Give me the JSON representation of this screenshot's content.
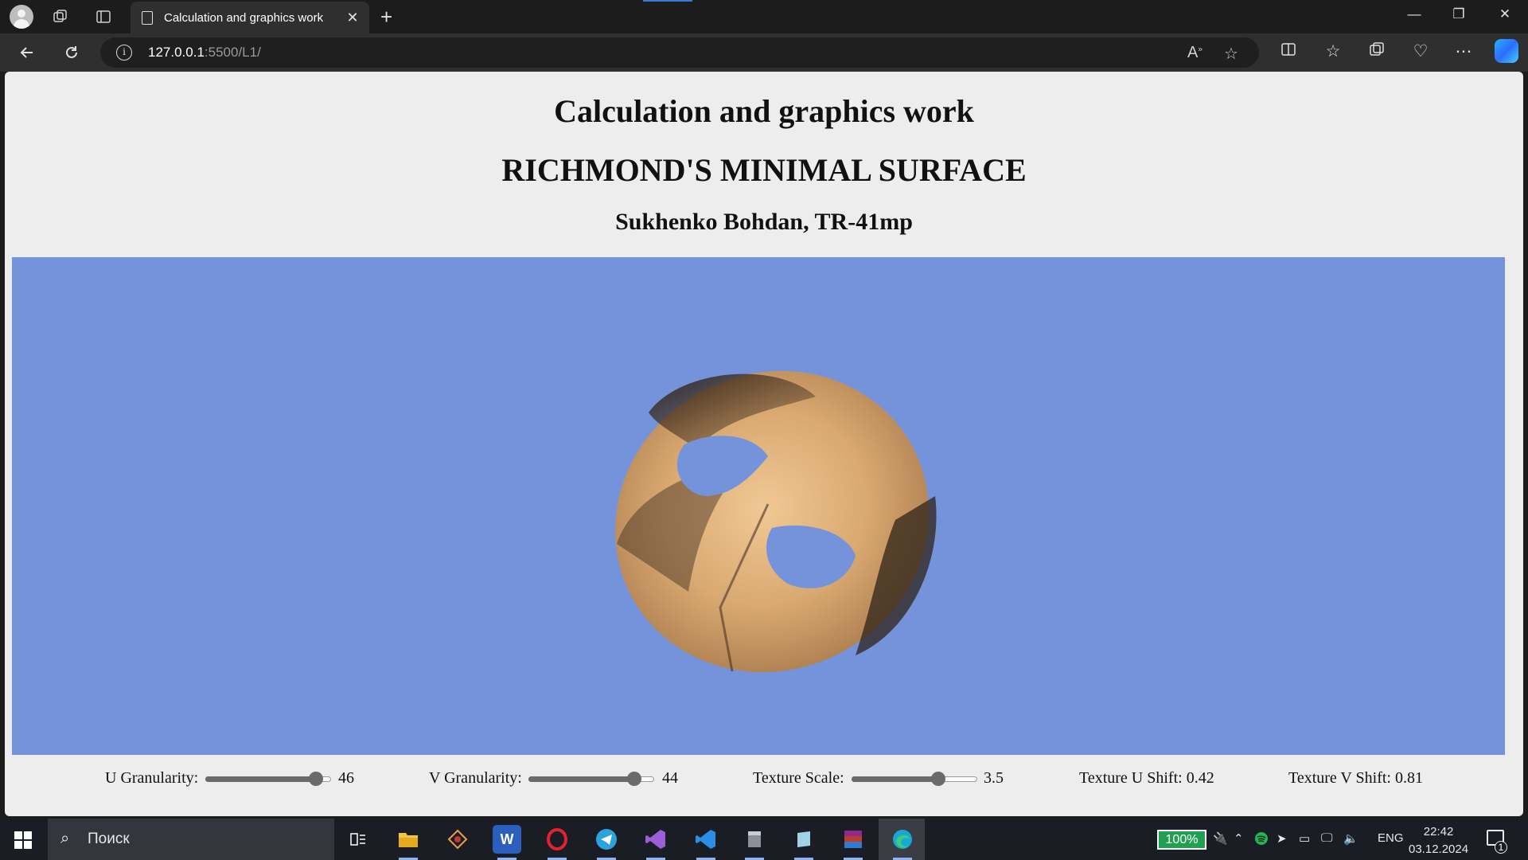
{
  "browser": {
    "tab_title": "Calculation and graphics work",
    "tab_close": "✕",
    "new_tab": "+",
    "url_host": "127.0.0.1",
    "url_path": ":5500/L1/",
    "window_minimize": "—",
    "window_restore": "❐",
    "window_close": "✕"
  },
  "page": {
    "title": "Calculation and graphics work",
    "subtitle": "RICHMOND'S MINIMAL SURFACE",
    "author": "Sukhenko Bohdan, TR-41mp"
  },
  "canvas": {
    "background_color": "#7493da",
    "surface_colors": [
      "#e2b47a",
      "#3a2a1e"
    ]
  },
  "controls": {
    "u_granularity": {
      "label": "U Granularity:",
      "value": "46",
      "fraction": 0.88
    },
    "v_granularity": {
      "label": "V Granularity:",
      "value": "44",
      "fraction": 0.84
    },
    "texture_scale": {
      "label": "Texture Scale:",
      "value": "3.5",
      "fraction": 0.69
    },
    "texture_u_shift": "Texture U Shift: 0.42",
    "texture_v_shift": "Texture V Shift: 0.81"
  },
  "taskbar": {
    "search_placeholder": "Поиск",
    "battery": "100%",
    "language": "ENG",
    "time": "22:42",
    "date": "03.12.2024",
    "notifications": "1",
    "apps": [
      "task-view",
      "file-explorer",
      "app-1",
      "word",
      "opera",
      "telegram",
      "visual-studio",
      "vscode",
      "app-2",
      "app-3",
      "winrar",
      "edge"
    ]
  },
  "colors": {
    "accent": "#3a7bd5",
    "battery_green": "#20a050"
  }
}
